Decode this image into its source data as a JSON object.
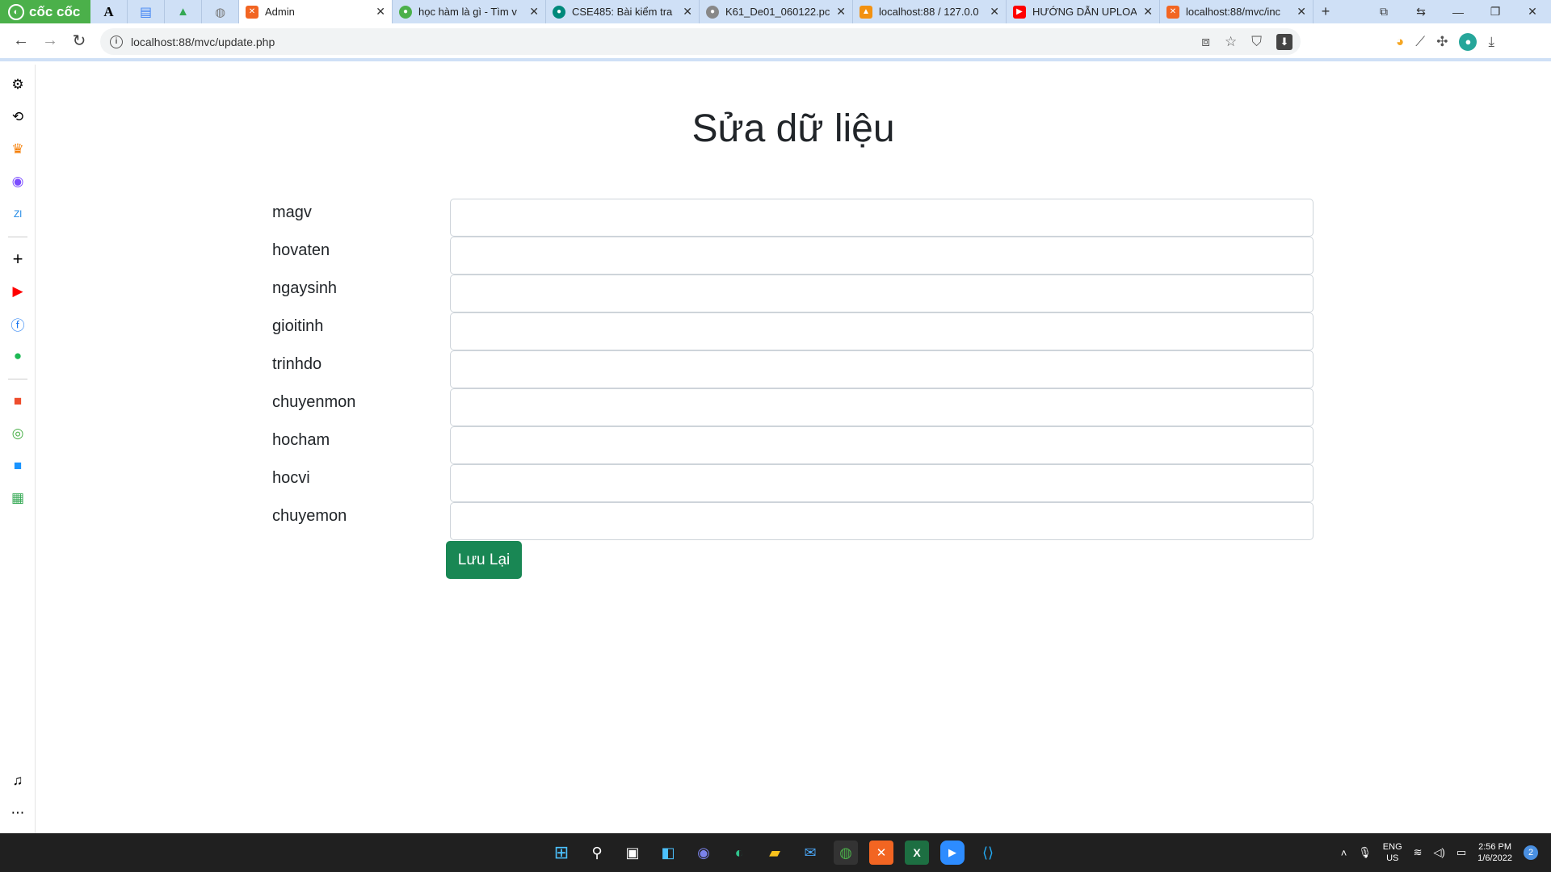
{
  "browser": {
    "brand": "cốc cốc",
    "tabs": [
      {
        "label": "",
        "icon": "font-icon",
        "color": "#222222",
        "active": false
      },
      {
        "label": "",
        "icon": "docs-icon",
        "color": "#4285f4",
        "active": false
      },
      {
        "label": "",
        "icon": "drive-icon",
        "color": "#34a853",
        "active": false
      },
      {
        "label": "",
        "icon": "globe-icon",
        "color": "#777777",
        "active": false
      },
      {
        "label": "Admin",
        "icon": "xampp-icon",
        "color": "#f26522",
        "active": true
      },
      {
        "label": "học hàm là gì - Tìm v",
        "icon": "coccoc-search-icon",
        "color": "#4bb04a",
        "active": false
      },
      {
        "label": "CSE485: Bài kiểm tra",
        "icon": "meet-icon",
        "color": "#00897b",
        "active": false
      },
      {
        "label": "K61_De01_060122.pc",
        "icon": "globe-icon",
        "color": "#777777",
        "active": false
      },
      {
        "label": "localhost:88 / 127.0.0",
        "icon": "phpmyadmin-icon",
        "color": "#f29111",
        "active": false
      },
      {
        "label": "HƯỚNG DẪN UPLOA",
        "icon": "youtube-icon",
        "color": "#ff0000",
        "active": false
      },
      {
        "label": "localhost:88/mvc/inc",
        "icon": "xampp-icon",
        "color": "#f26522",
        "active": false
      }
    ],
    "url": "localhost:88/mvc/update.php"
  },
  "page": {
    "title": "Sửa dữ liệu",
    "fields": [
      {
        "label": "magv",
        "value": ""
      },
      {
        "label": "hovaten",
        "value": ""
      },
      {
        "label": "ngaysinh",
        "value": ""
      },
      {
        "label": "gioitinh",
        "value": ""
      },
      {
        "label": "trinhdo",
        "value": ""
      },
      {
        "label": "chuyenmon",
        "value": ""
      },
      {
        "label": "hocham",
        "value": ""
      },
      {
        "label": "hocvi",
        "value": ""
      },
      {
        "label": "chuyemon",
        "value": ""
      }
    ],
    "save_label": "Lưu Lại",
    "save_color": "#198754"
  },
  "taskbar": {
    "language": "ENG",
    "region": "US",
    "time": "2:56 PM",
    "date": "1/6/2022",
    "notifications": "2"
  }
}
